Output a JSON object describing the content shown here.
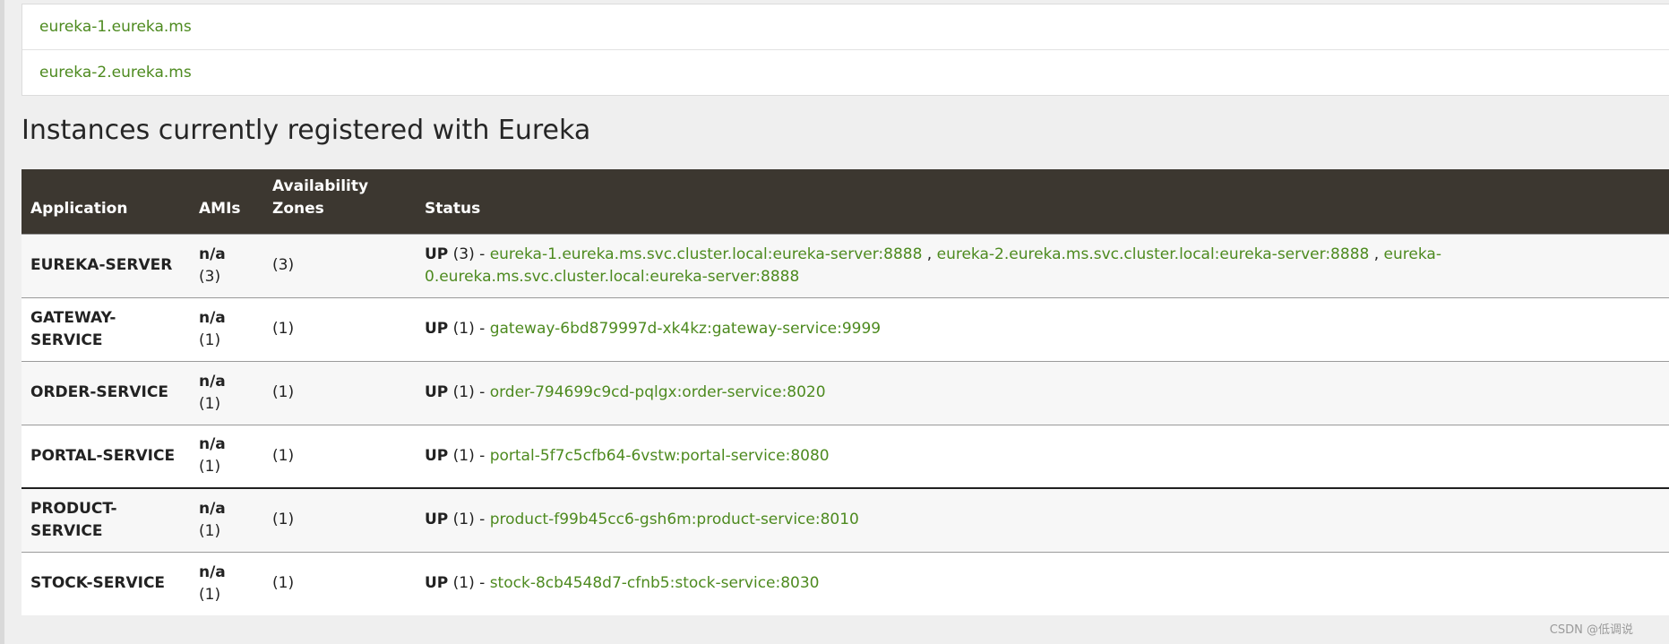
{
  "replicas": [
    {
      "host": "eureka-1.eureka.ms"
    },
    {
      "host": "eureka-2.eureka.ms"
    }
  ],
  "instances_heading": "Instances currently registered with Eureka",
  "table": {
    "headers": {
      "application": "Application",
      "amis": "AMIs",
      "zones": "Availability Zones",
      "status": "Status"
    },
    "rows": [
      {
        "application": "EUREKA-SERVER",
        "amis_label": "n/a",
        "amis_count": "(3)",
        "zones": "(3)",
        "status": "UP",
        "status_count": "(3) -",
        "instances": [
          "eureka-1.eureka.ms.svc.cluster.local:eureka-server:8888",
          "eureka-2.eureka.ms.svc.cluster.local:eureka-server:8888",
          "eureka-0.eureka.ms.svc.cluster.local:eureka-server:8888"
        ]
      },
      {
        "application": "GATEWAY-SERVICE",
        "amis_label": "n/a",
        "amis_count": "(1)",
        "zones": "(1)",
        "status": "UP",
        "status_count": "(1) -",
        "instances": [
          "gateway-6bd879997d-xk4kz:gateway-service:9999"
        ]
      },
      {
        "application": "ORDER-SERVICE",
        "amis_label": "n/a",
        "amis_count": "(1)",
        "zones": "(1)",
        "status": "UP",
        "status_count": "(1) -",
        "instances": [
          "order-794699c9cd-pqlgx:order-service:8020"
        ]
      },
      {
        "application": "PORTAL-SERVICE",
        "amis_label": "n/a",
        "amis_count": "(1)",
        "zones": "(1)",
        "status": "UP",
        "status_count": "(1) -",
        "instances": [
          "portal-5f7c5cfb64-6vstw:portal-service:8080"
        ]
      },
      {
        "application": "PRODUCT-SERVICE",
        "amis_label": "n/a",
        "amis_count": "(1)",
        "zones": "(1)",
        "status": "UP",
        "status_count": "(1) -",
        "instances": [
          "product-f99b45cc6-gsh6m:product-service:8010"
        ]
      },
      {
        "application": "STOCK-SERVICE",
        "amis_label": "n/a",
        "amis_count": "(1)",
        "zones": "(1)",
        "status": "UP",
        "status_count": "(1) -",
        "instances": [
          "stock-8cb4548d7-cfnb5:stock-service:8030"
        ]
      }
    ]
  },
  "watermark": "CSDN @低调说",
  "colors": {
    "link": "#4d8a1f",
    "header_bg": "#3c3730",
    "page_bg": "#efefef"
  }
}
